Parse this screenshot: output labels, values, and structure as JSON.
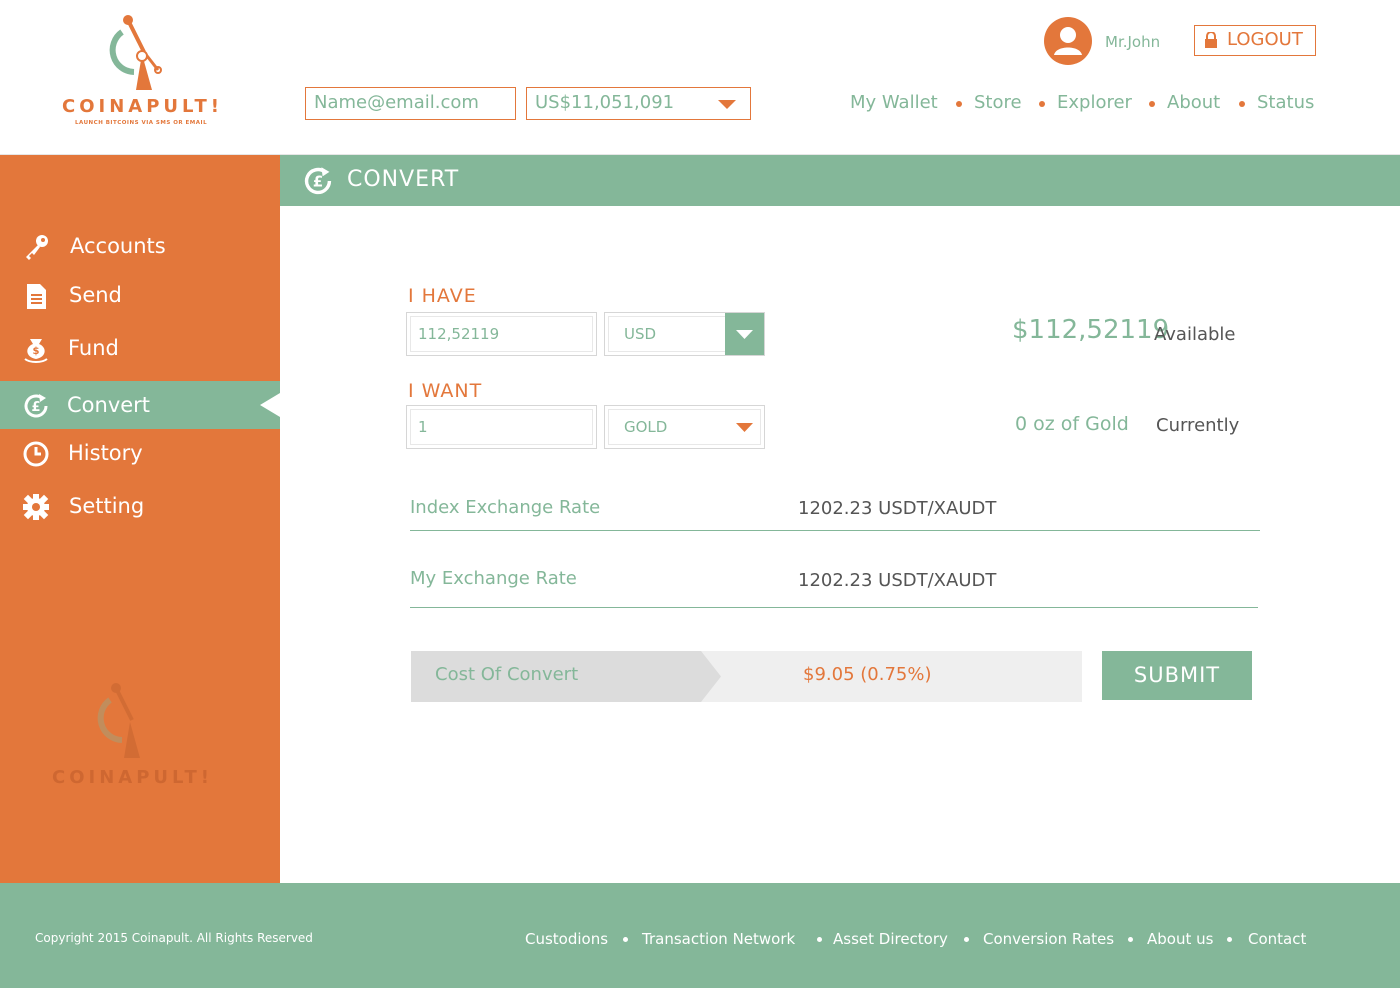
{
  "colors": {
    "orange": "#e3773b",
    "green": "#84b799",
    "gray": "#dcdcdc",
    "light": "#efefef"
  },
  "header": {
    "logo_word": "COINAPULT!",
    "logo_tagline": "LAUNCH BITCOINS VIA SMS OR EMAIL",
    "email_placeholder": "Name@email.com",
    "balance_value": "US$11,051,091",
    "user_name": "Mr.John",
    "logout_label": "LOGOUT",
    "nav": [
      "My Wallet",
      "Store",
      "Explorer",
      "About",
      "Status"
    ]
  },
  "sidebar": {
    "items": [
      {
        "label": "Accounts",
        "icon": "key-icon"
      },
      {
        "label": "Send",
        "icon": "document-icon"
      },
      {
        "label": "Fund",
        "icon": "coin-bag-icon"
      },
      {
        "label": "Convert",
        "icon": "convert-icon"
      },
      {
        "label": "History",
        "icon": "clock-icon"
      },
      {
        "label": "Setting",
        "icon": "gear-icon"
      }
    ],
    "watermark_word": "COINAPULT!"
  },
  "main": {
    "title": "CONVERT",
    "have": {
      "label": "I HAVE",
      "amount": "112,52119",
      "currency": "USD",
      "available_value": "$112,52119",
      "available_label": "Available"
    },
    "want": {
      "label": "I WANT",
      "amount": "1",
      "currency": "GOLD",
      "current_value": "0 oz of Gold",
      "current_label": "Currently"
    },
    "index_rate": {
      "label": "Index Exchange Rate",
      "value": "1202.23 USDT/XAUDT"
    },
    "my_rate": {
      "label": "My Exchange Rate",
      "value": "1202.23 USDT/XAUDT"
    },
    "cost": {
      "label": "Cost Of Convert",
      "value": "$9.05 (0.75%)"
    },
    "submit_label": "SUBMIT"
  },
  "footer": {
    "copyright": "Copyright 2015 Coinapult. All Rights Reserved",
    "links": [
      "Custodions",
      "Transaction Network",
      "Asset Directory",
      "Conversion Rates",
      "About us",
      "Contact"
    ]
  }
}
